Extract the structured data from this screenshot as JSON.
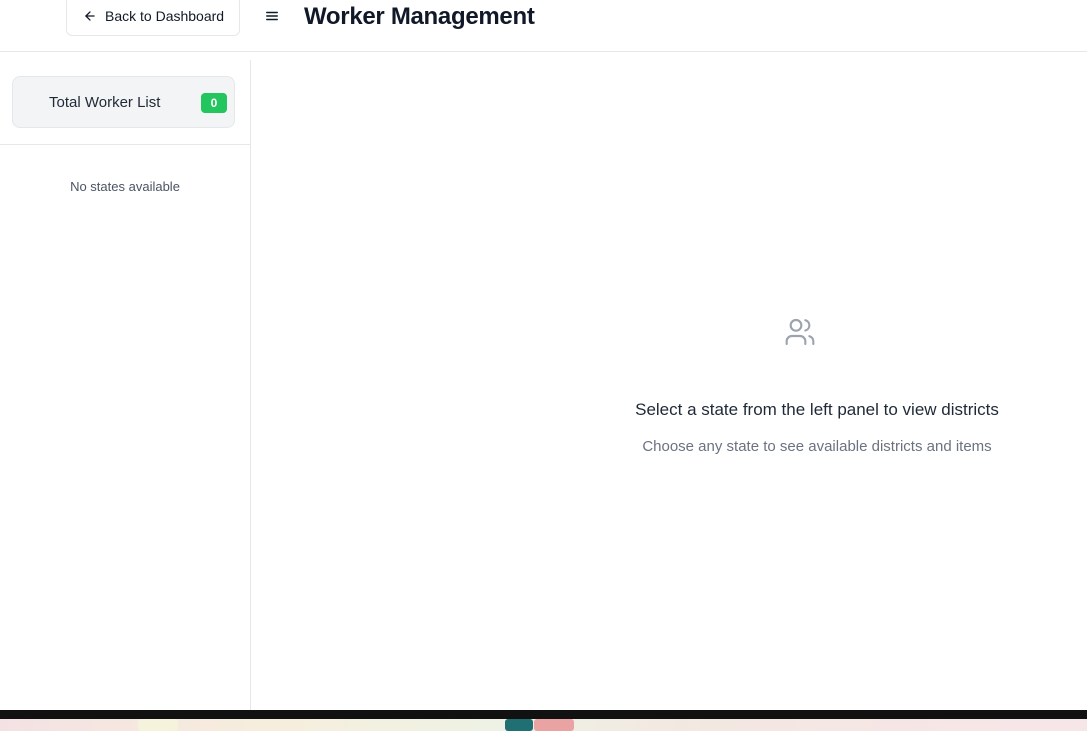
{
  "header": {
    "back_label": "Back to Dashboard",
    "title": "Worker Management"
  },
  "sidebar": {
    "total_label": "Total Worker List",
    "total_count": "0",
    "empty_message": "No states available"
  },
  "main": {
    "heading": "Select a state from the left panel to view districts",
    "subtext": "Choose any state to see available districts and items"
  },
  "colors": {
    "badge_green": "#22c55e",
    "muted_text": "#6b7280",
    "border": "#e5e7eb"
  },
  "icons": {
    "back": "arrow-left-icon",
    "menu": "menu-icon",
    "empty_state": "users-icon"
  }
}
